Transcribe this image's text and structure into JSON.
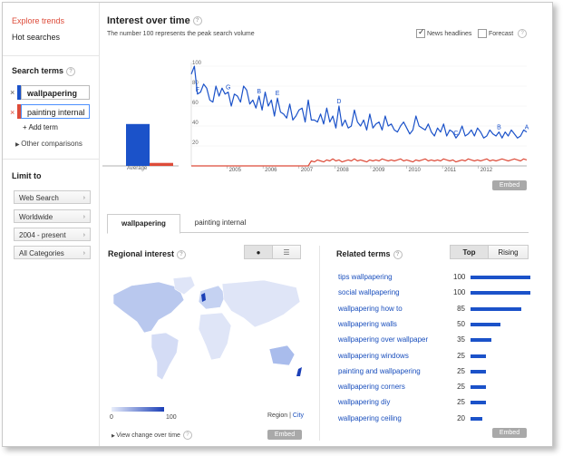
{
  "nav": {
    "explore": "Explore trends",
    "hot": "Hot searches"
  },
  "search_terms": {
    "title": "Search terms",
    "terms": [
      {
        "label": "wallpapering",
        "color": "#1b52c9"
      },
      {
        "label": "painting internal",
        "color": "#dd4b39"
      }
    ],
    "add_term": "Add term",
    "other": "Other comparisons"
  },
  "limit": {
    "title": "Limit to",
    "filters": [
      "Web Search",
      "Worldwide",
      "2004 - present",
      "All Categories"
    ]
  },
  "interest": {
    "title": "Interest over time",
    "subtitle": "The number 100 represents the peak search volume",
    "news_headlines": "News headlines",
    "forecast": "Forecast",
    "embed": "Embed"
  },
  "chart_data": {
    "type": "line",
    "x_ticks": [
      "2005",
      "2006",
      "2007",
      "2008",
      "2009",
      "2010",
      "2011",
      "2012"
    ],
    "y_ticks": [
      100,
      80,
      60,
      40,
      20
    ],
    "ylim": [
      0,
      100
    ],
    "average_label": "Average",
    "averages": [
      {
        "name": "wallpapering",
        "value": 42
      },
      {
        "name": "painting internal",
        "value": 3
      }
    ],
    "news_markers": [
      "F",
      "G",
      "B",
      "E",
      "D",
      "C",
      "B",
      "A"
    ],
    "series": [
      {
        "name": "wallpapering",
        "color": "#1b52c9",
        "values": [
          92,
          100,
          72,
          74,
          82,
          78,
          66,
          64,
          80,
          70,
          78,
          72,
          74,
          60,
          72,
          70,
          64,
          80,
          76,
          62,
          66,
          58,
          70,
          56,
          74,
          60,
          66,
          50,
          68,
          54,
          52,
          48,
          62,
          46,
          50,
          56,
          58,
          44,
          66,
          46,
          46,
          44,
          52,
          42,
          58,
          44,
          50,
          38,
          60,
          40,
          46,
          38,
          40,
          56,
          44,
          40,
          46,
          36,
          52,
          38,
          42,
          44,
          36,
          50,
          40,
          42,
          36,
          34,
          40,
          44,
          38,
          32,
          36,
          50,
          40,
          38,
          36,
          42,
          34,
          30,
          38,
          34,
          42,
          30,
          36,
          34,
          28,
          32,
          40,
          30,
          32,
          36,
          30,
          38,
          34,
          28,
          30,
          36,
          32,
          30,
          34,
          28,
          34,
          30,
          36,
          32,
          28,
          30,
          36,
          34
        ]
      },
      {
        "name": "painting internal",
        "color": "#dd4b39",
        "values": [
          0,
          0,
          0,
          0,
          0,
          0,
          0,
          0,
          0,
          0,
          0,
          0,
          0,
          0,
          0,
          0,
          0,
          0,
          0,
          0,
          0,
          0,
          0,
          0,
          0,
          0,
          0,
          0,
          0,
          0,
          0,
          0,
          0,
          0,
          0,
          0,
          0,
          0,
          0,
          5,
          4,
          6,
          5,
          4,
          6,
          5,
          7,
          5,
          6,
          4,
          5,
          6,
          5,
          7,
          5,
          6,
          5,
          4,
          6,
          5,
          6,
          5,
          7,
          6,
          5,
          6,
          5,
          6,
          7,
          5,
          6,
          5,
          4,
          6,
          5,
          6,
          7,
          5,
          6,
          5,
          6,
          5,
          7,
          6,
          5,
          6,
          4,
          5,
          6,
          5,
          7,
          6,
          5,
          6,
          5,
          6,
          7,
          5,
          6,
          5,
          6,
          7,
          6,
          5,
          6,
          7,
          6,
          5,
          7,
          6
        ]
      }
    ]
  },
  "tabs": {
    "tab1": "wallpapering",
    "tab2": "painting internal"
  },
  "regional": {
    "title": "Regional interest",
    "legend_min": "0",
    "legend_max": "100",
    "region": "Region",
    "city": "City",
    "view_change": "View change over time",
    "embed": "Embed"
  },
  "related": {
    "title": "Related terms",
    "top": "Top",
    "rising": "Rising",
    "items": [
      {
        "term": "tips wallpapering",
        "value": 100
      },
      {
        "term": "social wallpapering",
        "value": 100
      },
      {
        "term": "wallpapering how to",
        "value": 85
      },
      {
        "term": "wallpapering walls",
        "value": 50
      },
      {
        "term": "wallpapering over wallpaper",
        "value": 35
      },
      {
        "term": "wallpapering windows",
        "value": 25
      },
      {
        "term": "painting and wallpapering",
        "value": 25
      },
      {
        "term": "wallpapering corners",
        "value": 25
      },
      {
        "term": "wallpapering diy",
        "value": 25
      },
      {
        "term": "wallpapering ceiling",
        "value": 20
      }
    ],
    "embed": "Embed"
  }
}
